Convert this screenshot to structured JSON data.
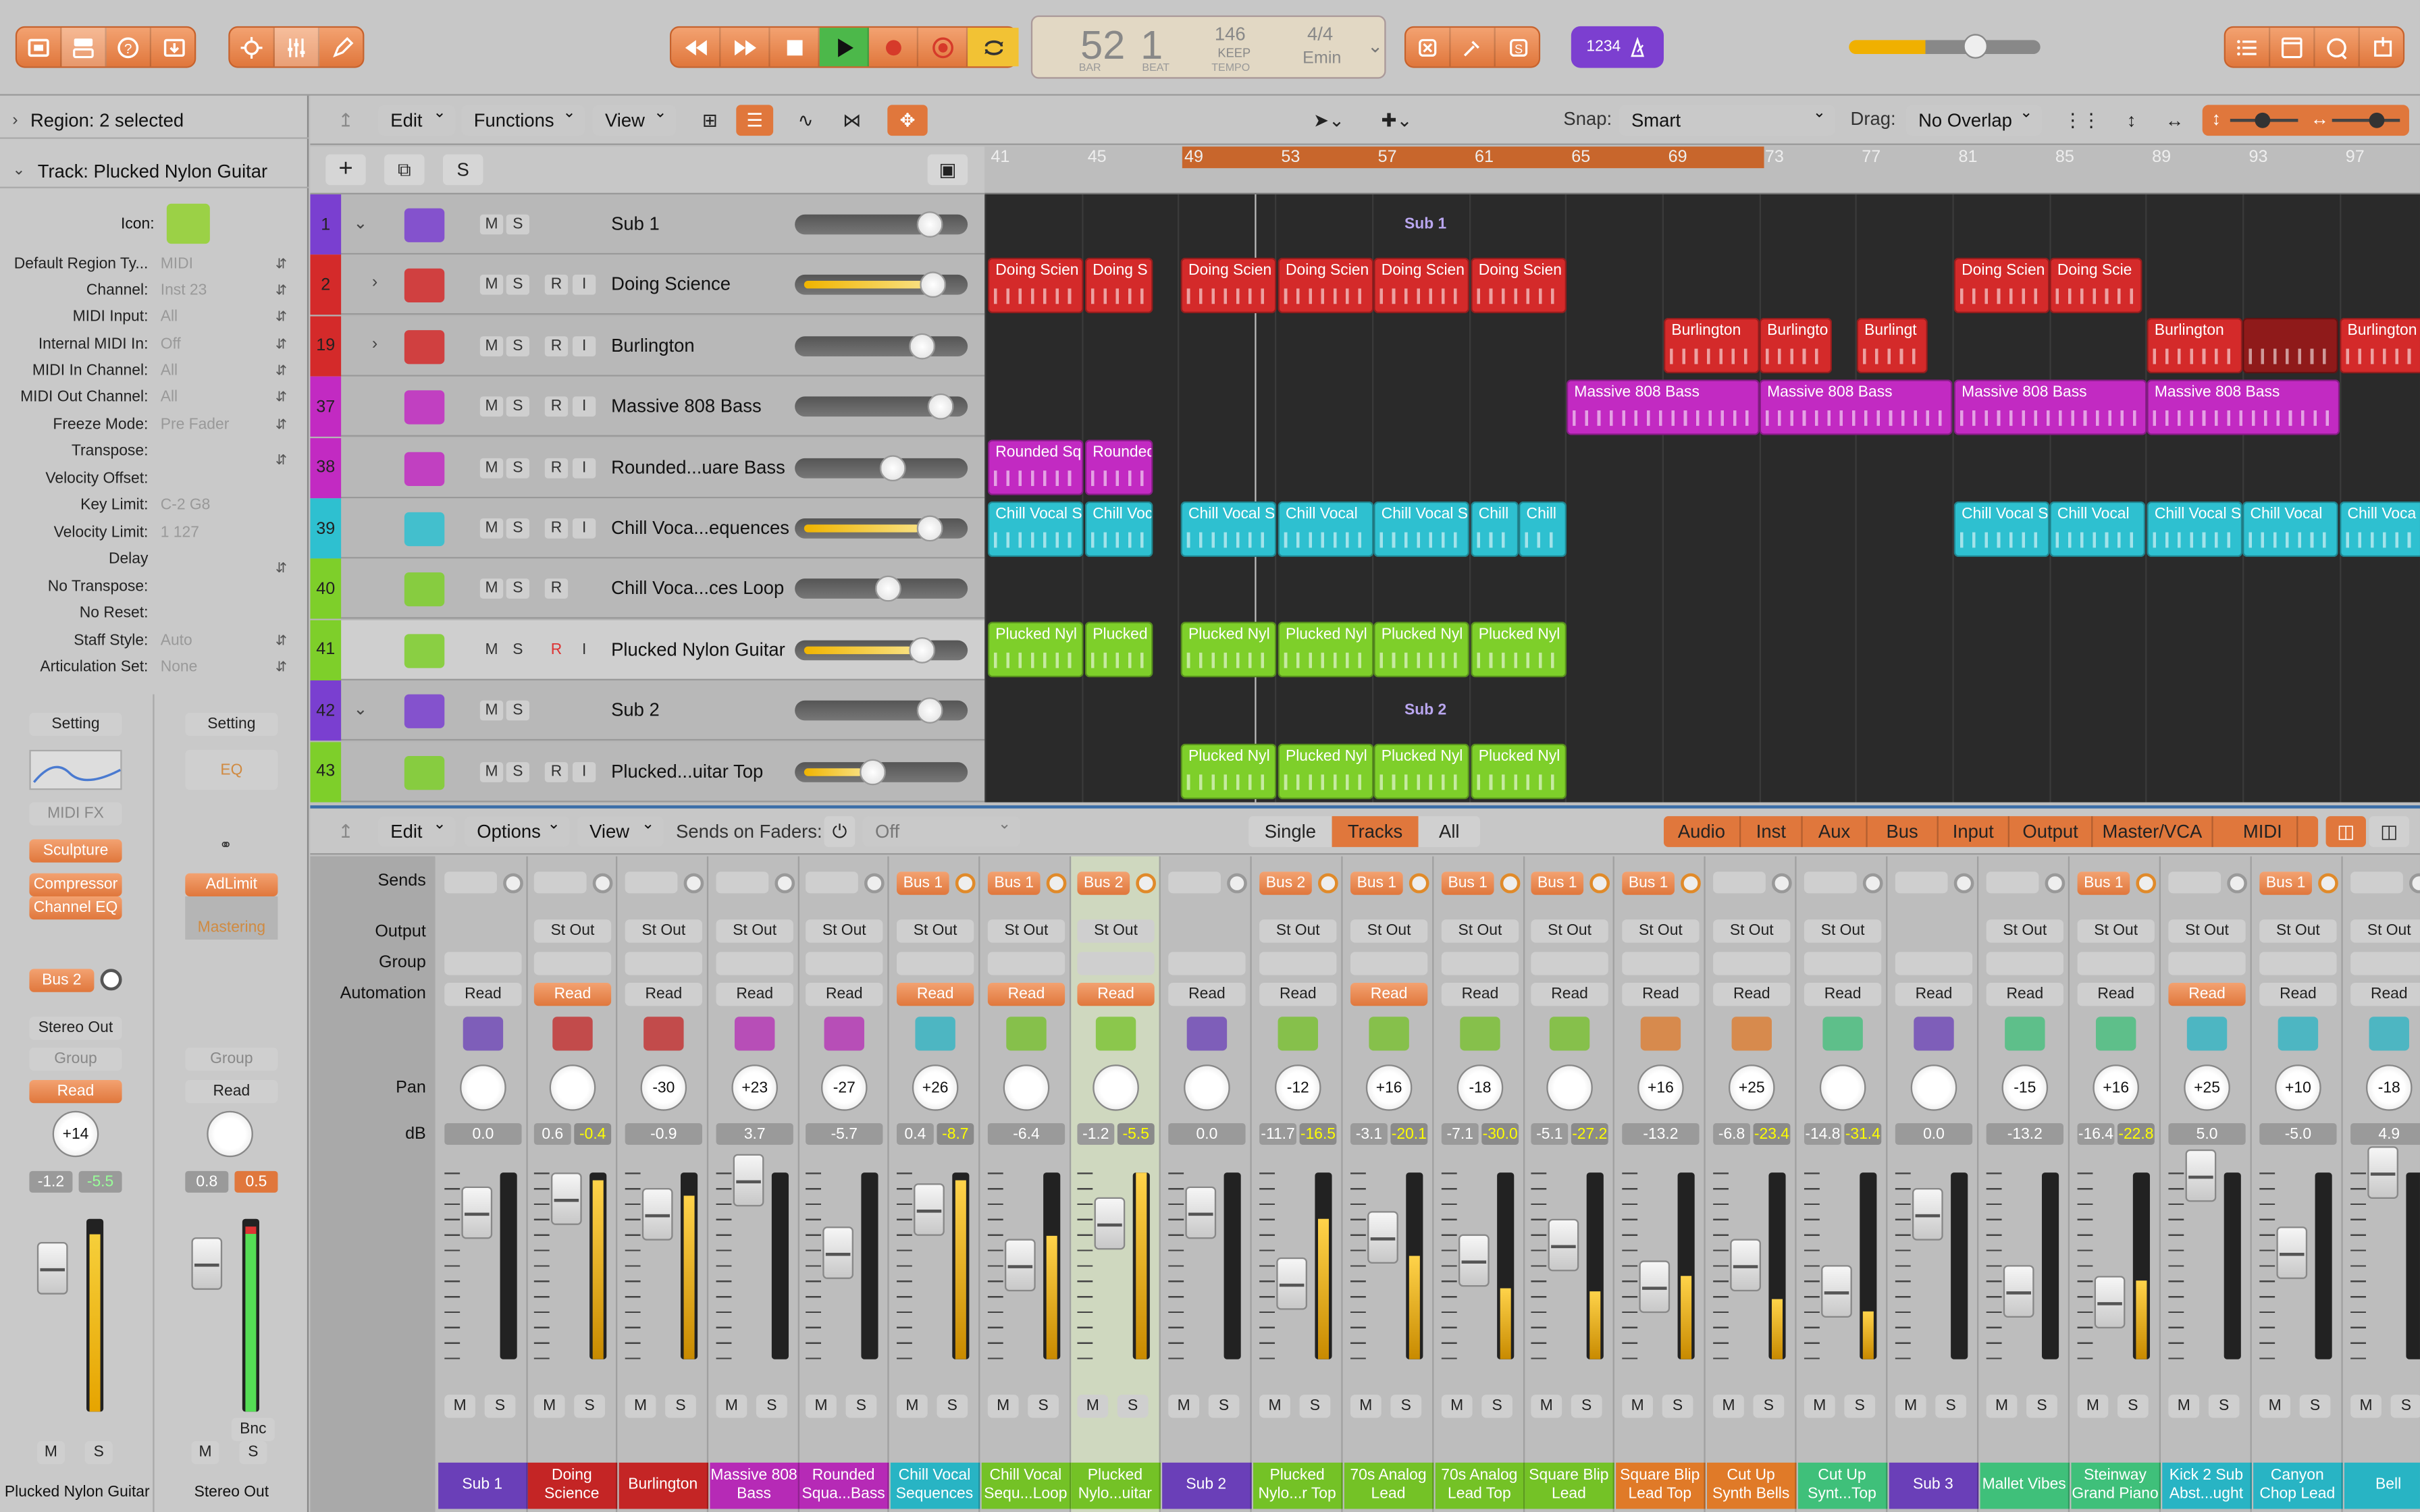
{
  "toolbar": {
    "lcd": {
      "bar": "52",
      "beat": "1",
      "bar_label": "BAR",
      "beat_label": "BEAT",
      "tempo": "146",
      "keep": "KEEP",
      "tempo_label": "TEMPO",
      "signature": "4/4",
      "key": "Emin"
    },
    "midi_badge": "1234"
  },
  "inspector": {
    "region": "Region: 2 selected",
    "track": "Track:  Plucked Nylon Guitar",
    "icon_label": "Icon:",
    "rows": [
      {
        "label": "Default Region Ty...",
        "value": "MIDI"
      },
      {
        "label": "Channel:",
        "value": "Inst 23"
      },
      {
        "label": "MIDI Input:",
        "value": "All"
      },
      {
        "label": "Internal MIDI In:",
        "value": "Off"
      },
      {
        "label": "MIDI In Channel:",
        "value": "All"
      },
      {
        "label": "MIDI Out Channel:",
        "value": "All"
      },
      {
        "label": "Freeze Mode:",
        "value": "Pre Fader"
      },
      {
        "label": "Transpose:",
        "value": ""
      },
      {
        "label": "Velocity Offset:",
        "value": ""
      },
      {
        "label": "Key Limit:",
        "value": "C-2  G8"
      },
      {
        "label": "Velocity Limit:",
        "value": "1  127"
      },
      {
        "label": "Delay",
        "value": ""
      },
      {
        "label": "No Transpose:",
        "value": ""
      },
      {
        "label": "No Reset:",
        "value": ""
      },
      {
        "label": "Staff Style:",
        "value": "Auto"
      },
      {
        "label": "Articulation Set:",
        "value": "None"
      }
    ],
    "left_strip": {
      "setting": "Setting",
      "midi_fx": "MIDI FX",
      "inst": "Sculpture",
      "fx1": "Compressor",
      "fx2": "Channel EQ",
      "send": "Bus 2",
      "output": "Stereo Out",
      "group": "Group",
      "auto": "Read",
      "pan": "+14",
      "db1": "-1.2",
      "db2": "-5.5",
      "m": "M",
      "s": "S",
      "name": "Plucked Nylon Guitar"
    },
    "right_strip": {
      "setting": "Setting",
      "eq": "EQ",
      "fx1": "AdLimit",
      "mastering": "Mastering",
      "group": "Group",
      "auto": "Read",
      "db1": "0.8",
      "db2": "0.5",
      "bnc": "Bnc",
      "m": "M",
      "s": "S",
      "name": "Stereo Out"
    }
  },
  "tracks_toolbar": {
    "edit": "Edit",
    "functions": "Functions",
    "view": "View",
    "snap_label": "Snap:",
    "snap": "Smart",
    "drag_label": "Drag:",
    "drag": "No Overlap",
    "s_btn": "S"
  },
  "ruler": [
    "41",
    "45",
    "49",
    "53",
    "57",
    "61",
    "65",
    "69",
    "73",
    "77",
    "81",
    "85",
    "89",
    "93",
    "97"
  ],
  "tracks": [
    {
      "num": "1",
      "name": "Sub 1",
      "color": "#7a3fd0",
      "folder": true
    },
    {
      "num": "2",
      "name": "Doing Science",
      "color": "#d42a2a",
      "folder": true
    },
    {
      "num": "19",
      "name": "Burlington",
      "color": "#d42a2a",
      "folder": true
    },
    {
      "num": "37",
      "name": "Massive 808 Bass",
      "color": "#c22ac2"
    },
    {
      "num": "38",
      "name": "Rounded...uare Bass",
      "color": "#c22ac2"
    },
    {
      "num": "39",
      "name": "Chill Voca...equences",
      "color": "#2ec0d0"
    },
    {
      "num": "40",
      "name": "Chill Voca...ces Loop",
      "color": "#7ecf2a"
    },
    {
      "num": "41",
      "name": "Plucked Nylon Guitar",
      "color": "#7ecf2a"
    },
    {
      "num": "42",
      "name": "Sub 2",
      "color": "#7a3fd0",
      "folder": true
    },
    {
      "num": "43",
      "name": "Plucked...uitar Top",
      "color": "#7ecf2a"
    }
  ],
  "track_buttons": {
    "m": "M",
    "s": "S",
    "r": "R",
    "i": "I"
  },
  "summary_labels": {
    "sub1": "Sub 1",
    "sub2": "Sub 2"
  },
  "regions": {
    "doing": "Doing Scien",
    "doing_s": "Doing S",
    "doing_scie": "Doing Scie",
    "burl": "Burlington",
    "burlingto": "Burlingto",
    "burlingt": "Burlingt",
    "massive": "Massive 808 Bass",
    "rounded_sq": "Rounded Sq",
    "rounded": "Rounded",
    "chill_s": "Chill Vocal S",
    "chill_voc": "Chill Voc",
    "chill": "Chill Vocal",
    "chill_short": "Chill",
    "chill_vocal_s": "Chill Vocal S",
    "chill_voca": "Chill Voca",
    "chill_vocal": "Chill Vocal",
    "chill_vocal2": "Chill Vocal",
    "chill_vocal3": "Chill Voca",
    "pluck_nyl": "Plucked Nyl",
    "pluck": "Plucked"
  },
  "mixer": {
    "edit": "Edit",
    "options": "Options",
    "view": "View",
    "sends_on_faders": "Sends on Faders:",
    "off": "Off",
    "single": "Single",
    "tracks": "Tracks",
    "all": "All",
    "filters": [
      "Audio",
      "Inst",
      "Aux",
      "Bus",
      "Input",
      "Output",
      "Master/VCA",
      "MIDI"
    ],
    "row_labels": {
      "sends": "Sends",
      "output": "Output",
      "group": "Group",
      "automation": "Automation",
      "pan": "Pan",
      "db": "dB"
    },
    "strips": [
      {
        "send": "",
        "out": "",
        "auto": "Read",
        "ao": false,
        "pan": "",
        "db": "0.0",
        "db2": "",
        "name": "Sub 1",
        "color": "#6a3fb8",
        "ms": "M|S"
      },
      {
        "send": "",
        "out": "St Out",
        "auto": "Read",
        "ao": true,
        "pan": "",
        "db": "0.6",
        "db2": "-0.4",
        "name": "Doing Science",
        "color": "#c42525",
        "ms": "M|S"
      },
      {
        "send": "",
        "out": "St Out",
        "auto": "Read",
        "ao": false,
        "pan": "-30",
        "db": "-0.9",
        "db2": "",
        "name": "Burlington",
        "color": "#c42525",
        "ms": "M|S"
      },
      {
        "send": "",
        "out": "St Out",
        "auto": "Read",
        "ao": false,
        "pan": "+23",
        "db": "3.7",
        "db2": "",
        "name": "Massive 808 Bass",
        "color": "#b62ab6",
        "ms": "M|S"
      },
      {
        "send": "",
        "out": "St Out",
        "auto": "Read",
        "ao": false,
        "pan": "-27",
        "db": "-5.7",
        "db2": "",
        "name": "Rounded Squa...Bass",
        "color": "#b62ab6",
        "ms": "M|S"
      },
      {
        "send": "Bus 1",
        "out": "St Out",
        "auto": "Read",
        "ao": true,
        "pan": "+26",
        "db": "0.4",
        "db2": "-8.7",
        "name": "Chill Vocal Sequences",
        "color": "#28b4c4",
        "ms": "M|S"
      },
      {
        "send": "Bus 1",
        "out": "St Out",
        "auto": "Read",
        "ao": true,
        "pan": "",
        "db": "-6.4",
        "db2": "",
        "name": "Chill Vocal Sequ...Loop",
        "color": "#74c226",
        "ms": "M|S"
      },
      {
        "send": "Bus 2",
        "out": "St Out",
        "auto": "Read",
        "ao": true,
        "pan": "",
        "db": "-1.2",
        "db2": "-5.5",
        "name": "Plucked Nylo...uitar",
        "color": "#74c226",
        "ms": "M|S"
      },
      {
        "send": "",
        "out": "",
        "auto": "Read",
        "ao": false,
        "pan": "",
        "db": "0.0",
        "db2": "",
        "name": "Sub 2",
        "color": "#6a3fb8",
        "ms": "M|S"
      },
      {
        "send": "Bus 2",
        "out": "St Out",
        "auto": "Read",
        "ao": false,
        "pan": "-12",
        "db": "-11.7",
        "db2": "-16.5",
        "name": "Plucked Nylo...r Top",
        "color": "#74c226",
        "ms": "M|S"
      },
      {
        "send": "Bus 1",
        "out": "St Out",
        "auto": "Read",
        "ao": true,
        "pan": "+16",
        "db": "-3.1",
        "db2": "-20.1",
        "name": "70s Analog Lead",
        "color": "#74c226",
        "ms": "M|S"
      },
      {
        "send": "Bus 1",
        "out": "St Out",
        "auto": "Read",
        "ao": false,
        "pan": "-18",
        "db": "-7.1",
        "db2": "-30.0",
        "name": "70s Analog Lead Top",
        "color": "#74c226",
        "ms": "M|S"
      },
      {
        "send": "Bus 1",
        "out": "St Out",
        "auto": "Read",
        "ao": false,
        "pan": "",
        "db": "-5.1",
        "db2": "-27.2",
        "name": "Square Blip Lead",
        "color": "#74c226",
        "ms": "M|S"
      },
      {
        "send": "Bus 1",
        "out": "St Out",
        "auto": "Read",
        "ao": false,
        "pan": "+16",
        "db": "-13.2",
        "db2": "",
        "name": "Square Blip Lead Top",
        "color": "#e07a28",
        "ms": "M|S"
      },
      {
        "send": "",
        "out": "St Out",
        "auto": "Read",
        "ao": false,
        "pan": "+25",
        "db": "-6.8",
        "db2": "-23.4",
        "name": "Cut Up Synth Bells",
        "color": "#e07a28",
        "ms": "M|S"
      },
      {
        "send": "",
        "out": "St Out",
        "auto": "Read",
        "ao": false,
        "pan": "",
        "db": "-14.8",
        "db2": "-31.4",
        "name": "Cut Up Synt...Top",
        "color": "#3fc07a",
        "ms": "M|S"
      },
      {
        "send": "",
        "out": "",
        "auto": "Read",
        "ao": false,
        "pan": "",
        "db": "0.0",
        "db2": "",
        "name": "Sub 3",
        "color": "#6a3fb8",
        "ms": "M|S"
      },
      {
        "send": "",
        "out": "St Out",
        "auto": "Read",
        "ao": false,
        "pan": "-15",
        "db": "-13.2",
        "db2": "",
        "name": "Mallet Vibes",
        "color": "#3fc07a",
        "ms": "M|S"
      },
      {
        "send": "Bus 1",
        "out": "St Out",
        "auto": "Read",
        "ao": false,
        "pan": "+16",
        "db": "-16.4",
        "db2": "-22.8",
        "name": "Steinway Grand Piano",
        "color": "#3fc07a",
        "ms": "M|S"
      },
      {
        "send": "",
        "out": "St Out",
        "auto": "Read",
        "ao": true,
        "pan": "+25",
        "db": "5.0",
        "db2": "",
        "name": "Kick 2 Sub Abst...ught",
        "color": "#28b4c4",
        "ms": "M|S"
      },
      {
        "send": "Bus 1",
        "out": "St Out",
        "auto": "Read",
        "ao": false,
        "pan": "+10",
        "db": "-5.0",
        "db2": "",
        "name": "Canyon Chop Lead",
        "color": "#28b4c4",
        "ms": "M|S"
      },
      {
        "send": "",
        "out": "St Out",
        "auto": "Read",
        "ao": false,
        "pan": "-18",
        "db": "4.9",
        "db2": "",
        "name": "Bell",
        "color": "#28b4c4",
        "ms": "M|S"
      }
    ]
  }
}
